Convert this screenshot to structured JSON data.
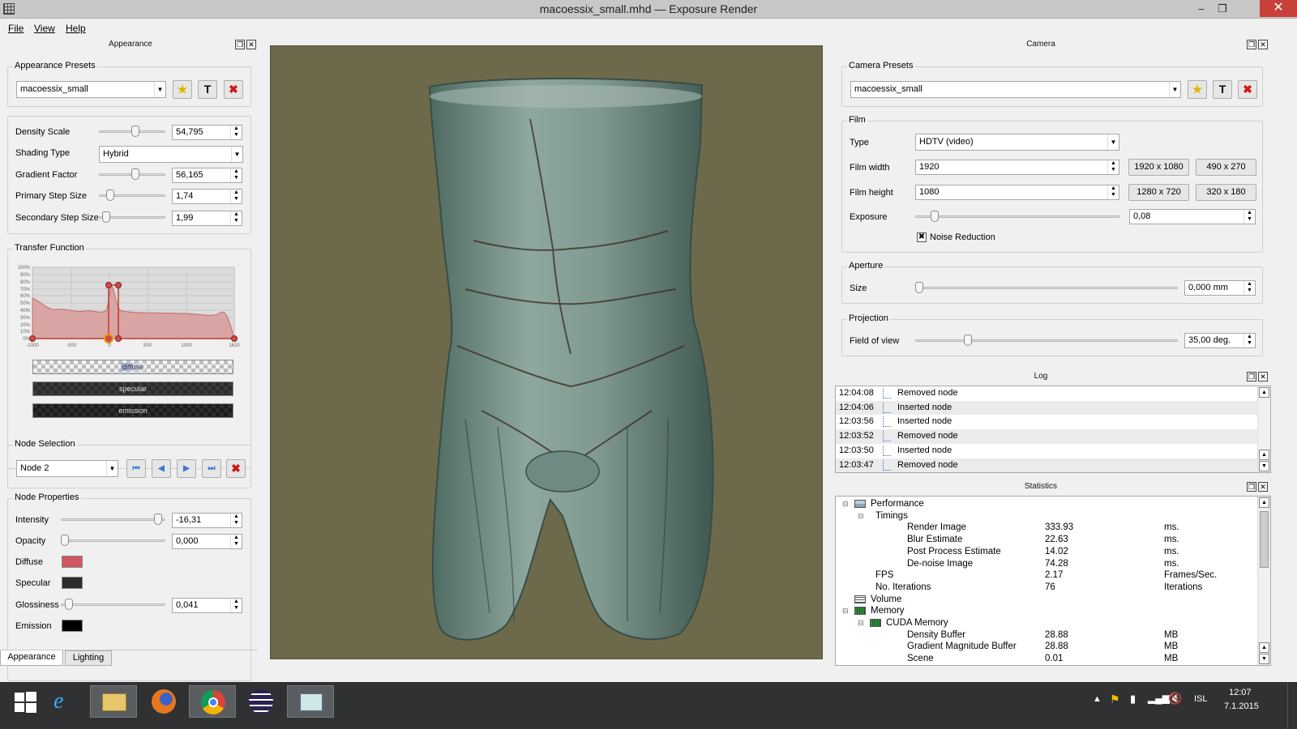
{
  "window": {
    "title": "macoessix_small.mhd — Exposure Render",
    "minimize": "–",
    "restore": "❐",
    "close": "✕"
  },
  "menu": [
    "File",
    "View",
    "Help"
  ],
  "appearance_dock": {
    "title": "Appearance",
    "presets": {
      "title": "Appearance Presets",
      "value": "macoessix_small"
    },
    "params": [
      {
        "label": "Density Scale",
        "value": "54,795",
        "level": 0.55
      },
      {
        "label": "Gradient Factor",
        "value": "56,165",
        "level": 0.56
      },
      {
        "label": "Primary Step Size",
        "value": "1,74",
        "level": 0.12
      },
      {
        "label": "Secondary Step Size",
        "value": "1,99",
        "level": 0.05
      }
    ],
    "shading": {
      "label": "Shading Type",
      "value": "Hybrid"
    },
    "transfer_function": {
      "title": "Transfer Function",
      "y_ticks": [
        "100%",
        "90%",
        "80%",
        "70%",
        "60%",
        "50%",
        "40%",
        "30%",
        "20%",
        "10%",
        "0%"
      ],
      "x_ticks": [
        "-1000",
        "-500",
        "0",
        "500",
        "1000",
        "1620"
      ],
      "bars": [
        "diffuse",
        "specular",
        "emission"
      ]
    },
    "node_selection": {
      "title": "Node Selection",
      "value": "Node 2"
    },
    "node_properties": {
      "title": "Node Properties",
      "intensity": {
        "label": "Intensity",
        "value": "-16,31",
        "level": 0.97
      },
      "opacity": {
        "label": "Opacity",
        "value": "0,000",
        "level": 0.0
      },
      "diffuse": {
        "label": "Diffuse",
        "color": "#d0575f"
      },
      "specular": {
        "label": "Specular",
        "color": "#2b2b2b"
      },
      "glossiness": {
        "label": "Glossiness",
        "value": "0,041",
        "level": 0.04
      },
      "emission": {
        "label": "Emission",
        "color": "#000000"
      }
    },
    "tabs": [
      "Appearance",
      "Lighting"
    ]
  },
  "camera_dock": {
    "title": "Camera",
    "presets": {
      "title": "Camera Presets",
      "value": "macoessix_small"
    },
    "film": {
      "title": "Film",
      "type_label": "Type",
      "type_value": "HDTV (video)",
      "width_label": "Film width",
      "width_value": "1920",
      "height_label": "Film height",
      "height_value": "1080",
      "presets": [
        "1920 x 1080",
        "490 x 270",
        "1280 x 720",
        "320 x 180"
      ],
      "exposure_label": "Exposure",
      "exposure_value": "0,08",
      "exposure_level": 0.08,
      "noise_label": "Noise Reduction",
      "noise_checked": true
    },
    "aperture": {
      "title": "Aperture",
      "size_label": "Size",
      "size_value": "0,000 mm",
      "level": 0.0
    },
    "projection": {
      "title": "Projection",
      "fov_label": "Field of view",
      "fov_value": "35,00 deg.",
      "level": 0.19
    }
  },
  "log": {
    "title": "Log",
    "rows": [
      {
        "time": "12:04:08",
        "msg": "Removed node"
      },
      {
        "time": "12:04:06",
        "msg": "Inserted node"
      },
      {
        "time": "12:03:56",
        "msg": "Inserted node"
      },
      {
        "time": "12:03:52",
        "msg": "Removed node"
      },
      {
        "time": "12:03:50",
        "msg": "Inserted node"
      },
      {
        "time": "12:03:47",
        "msg": "Removed node"
      }
    ]
  },
  "statistics": {
    "title": "Statistics",
    "rows": [
      {
        "name": "Performance",
        "value": "",
        "unit": "",
        "level": 0,
        "tog": "⊟",
        "icon": "chart"
      },
      {
        "name": "Timings",
        "value": "",
        "unit": "",
        "level": 1,
        "tog": "⊟",
        "icon": ""
      },
      {
        "name": "Render Image",
        "value": "333.93",
        "unit": "ms.",
        "level": 2,
        "tog": "",
        "icon": ""
      },
      {
        "name": "Blur Estimate",
        "value": "22.63",
        "unit": "ms.",
        "level": 2,
        "tog": "",
        "icon": ""
      },
      {
        "name": "Post Process Estimate",
        "value": "14.02",
        "unit": "ms.",
        "level": 2,
        "tog": "",
        "icon": ""
      },
      {
        "name": "De-noise Image",
        "value": "74.28",
        "unit": "ms.",
        "level": 2,
        "tog": "",
        "icon": ""
      },
      {
        "name": "FPS",
        "value": "2.17",
        "unit": "Frames/Sec.",
        "level": 1,
        "tog": "",
        "icon": ""
      },
      {
        "name": "No. Iterations",
        "value": "76",
        "unit": "Iterations",
        "level": 1,
        "tog": "",
        "icon": ""
      },
      {
        "name": "Volume",
        "value": "",
        "unit": "",
        "level": 0,
        "tog": "",
        "icon": "grid"
      },
      {
        "name": "Memory",
        "value": "",
        "unit": "",
        "level": 0,
        "tog": "⊟",
        "icon": "chip"
      },
      {
        "name": "CUDA Memory",
        "value": "",
        "unit": "",
        "level": 1,
        "tog": "⊟",
        "icon": "chip"
      },
      {
        "name": "Density Buffer",
        "value": "28.88",
        "unit": "MB",
        "level": 2,
        "tog": "",
        "icon": ""
      },
      {
        "name": "Gradient Magnitude Buffer",
        "value": "28.88",
        "unit": "MB",
        "level": 2,
        "tog": "",
        "icon": ""
      },
      {
        "name": "Scene",
        "value": "0.01",
        "unit": "MB",
        "level": 2,
        "tog": "",
        "icon": ""
      }
    ]
  },
  "taskbar": {
    "language": "ISL",
    "time": "12:07",
    "date": "7.1.2015"
  }
}
